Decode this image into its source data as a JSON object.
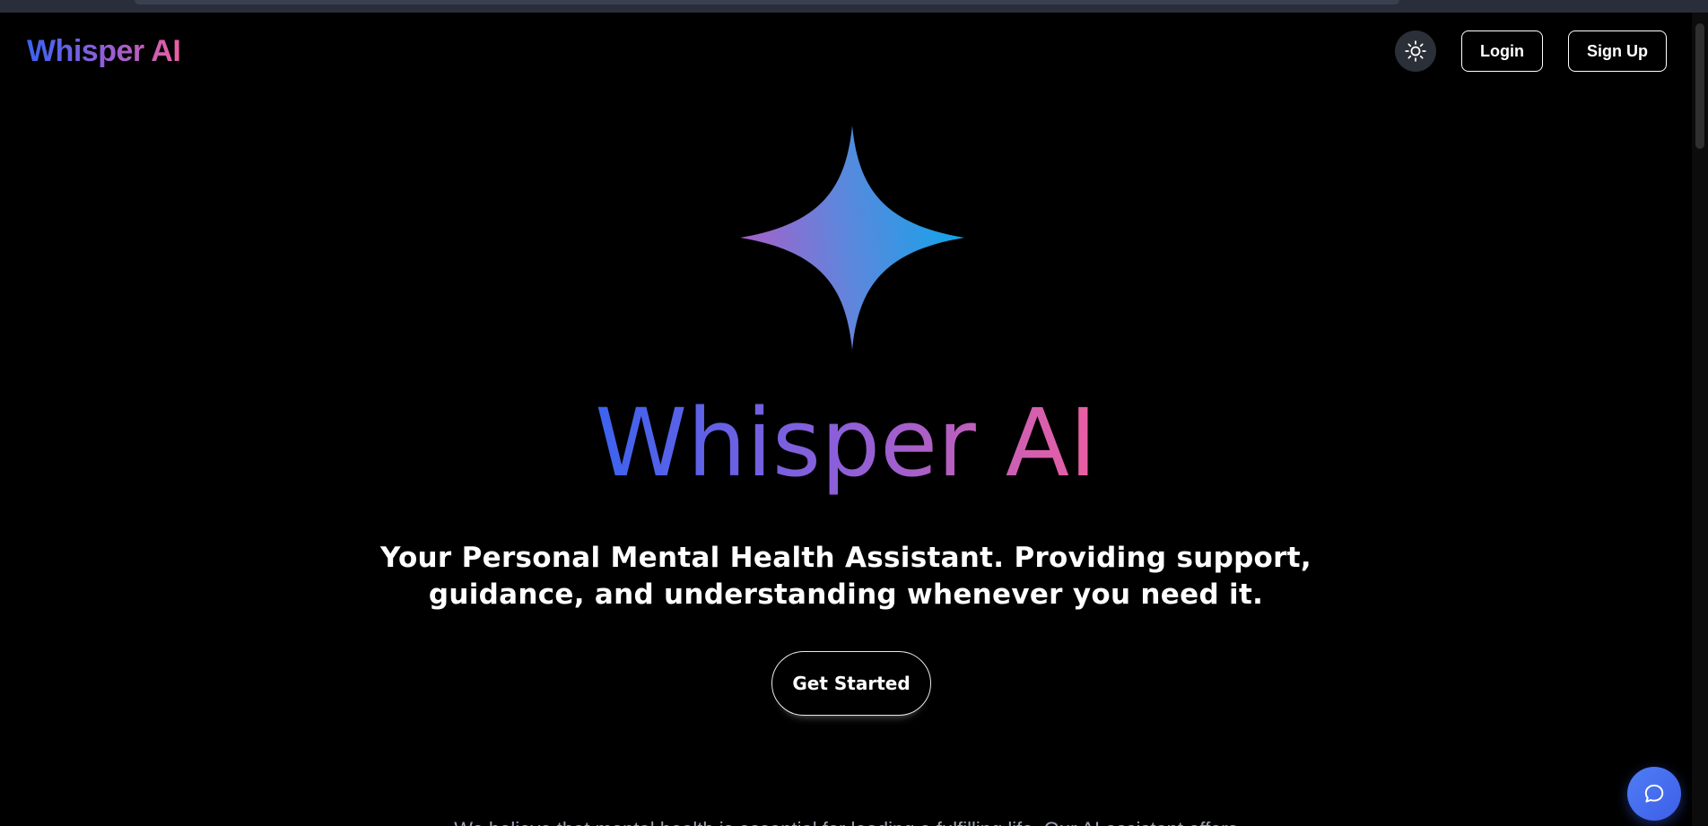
{
  "header": {
    "brand": "Whisper AI",
    "theme_icon": "sun-icon",
    "login_label": "Login",
    "signup_label": "Sign Up"
  },
  "hero": {
    "logo_icon": "sparkle-icon",
    "title": "Whisper AI",
    "tagline": "Your Personal Mental Health Assistant. Providing support, guidance, and understanding whenever you need it.",
    "cta_label": "Get Started"
  },
  "about": {
    "text": "We believe that mental health is essential for leading a fulfilling life. Our AI assistant offers"
  },
  "chat_widget": {
    "icon": "chat-bubble-icon"
  },
  "colors": {
    "background": "#000000",
    "gradient_start": "#3b63f0",
    "gradient_mid": "#8f5fd8",
    "gradient_end": "#ec5fa0",
    "sparkle_left": "#a85fc8",
    "sparkle_right": "#19a3e8",
    "chat_button": "#4f7df5"
  }
}
